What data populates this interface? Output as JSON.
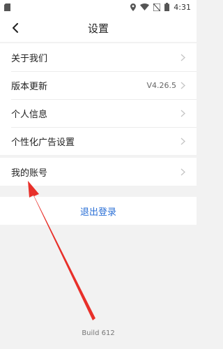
{
  "status_bar": {
    "time": "4:31",
    "icons": [
      "sd-card-icon",
      "location-icon",
      "wifi-icon",
      "no-sim-icon",
      "battery-icon"
    ]
  },
  "header": {
    "title": "设置",
    "back_icon": "chevron-left-icon"
  },
  "settings": {
    "items": [
      {
        "label": "关于我们",
        "value": ""
      },
      {
        "label": "版本更新",
        "value": "V4.26.5"
      },
      {
        "label": "个人信息",
        "value": ""
      },
      {
        "label": "个性化广告设置",
        "value": ""
      }
    ],
    "account": {
      "label": "我的账号"
    }
  },
  "logout": {
    "label": "退出登录"
  },
  "footer": {
    "build": "Build 612"
  },
  "colors": {
    "link": "#2a6fd6",
    "annotation_arrow": "#e8302a",
    "background": "#f2f2f2"
  }
}
